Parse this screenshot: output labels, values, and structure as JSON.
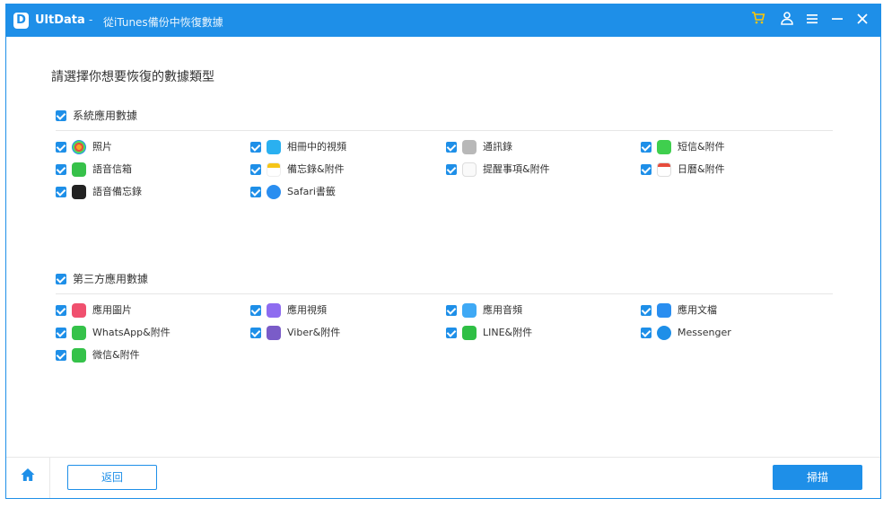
{
  "titlebar": {
    "app_name": "UltData",
    "separator": "-",
    "subtitle": "從iTunes備份中恢復數據",
    "logo_letter": "D",
    "accent": "#1e8fe8",
    "icons": [
      "cart-icon",
      "user-icon",
      "menu-icon",
      "minimize-icon",
      "close-icon"
    ]
  },
  "main": {
    "heading": "請選擇你想要恢復的數據類型"
  },
  "system_section": {
    "label": "系統應用數據",
    "items": [
      {
        "label": "照片",
        "icon": "photos-icon",
        "color": "#f5a623"
      },
      {
        "label": "相冊中的視頻",
        "icon": "album-video-icon",
        "color": "#2ab0f0"
      },
      {
        "label": "通訊錄",
        "icon": "contacts-icon",
        "color": "#b8b8b8"
      },
      {
        "label": "短信&附件",
        "icon": "messages-icon",
        "color": "#3fcf4e"
      },
      {
        "label": "語音信箱",
        "icon": "voicemail-icon",
        "color": "#37c14a"
      },
      {
        "label": "備忘錄&附件",
        "icon": "notes-icon",
        "color": "#f5c518"
      },
      {
        "label": "提醒事項&附件",
        "icon": "reminders-icon",
        "color": "#d8d8d8"
      },
      {
        "label": "日曆&附件",
        "icon": "calendar-icon",
        "color": "#e74c3c"
      },
      {
        "label": "語音備忘錄",
        "icon": "voice-memos-icon",
        "color": "#222222"
      },
      {
        "label": "Safari書籤",
        "icon": "safari-icon",
        "color": "#2a8ef0"
      }
    ]
  },
  "third_party_section": {
    "label": "第三方應用數據",
    "items": [
      {
        "label": "應用圖片",
        "icon": "app-photos-icon",
        "color": "#f0506e"
      },
      {
        "label": "應用視頻",
        "icon": "app-video-icon",
        "color": "#8e6cf0"
      },
      {
        "label": "應用音頻",
        "icon": "app-audio-icon",
        "color": "#3fa9f5"
      },
      {
        "label": "應用文檔",
        "icon": "app-document-icon",
        "color": "#2a8ef0"
      },
      {
        "label": "WhatsApp&附件",
        "icon": "whatsapp-icon",
        "color": "#35c24a"
      },
      {
        "label": "Viber&附件",
        "icon": "viber-icon",
        "color": "#7a5cc8"
      },
      {
        "label": "LINE&附件",
        "icon": "line-icon",
        "color": "#2fbf45"
      },
      {
        "label": "Messenger",
        "icon": "messenger-icon",
        "color": "#1e8fe8"
      },
      {
        "label": "微信&附件",
        "icon": "wechat-icon",
        "color": "#35c24a"
      }
    ]
  },
  "footer": {
    "back_label": "返回",
    "scan_label": "掃描",
    "home_icon": "home-icon"
  }
}
